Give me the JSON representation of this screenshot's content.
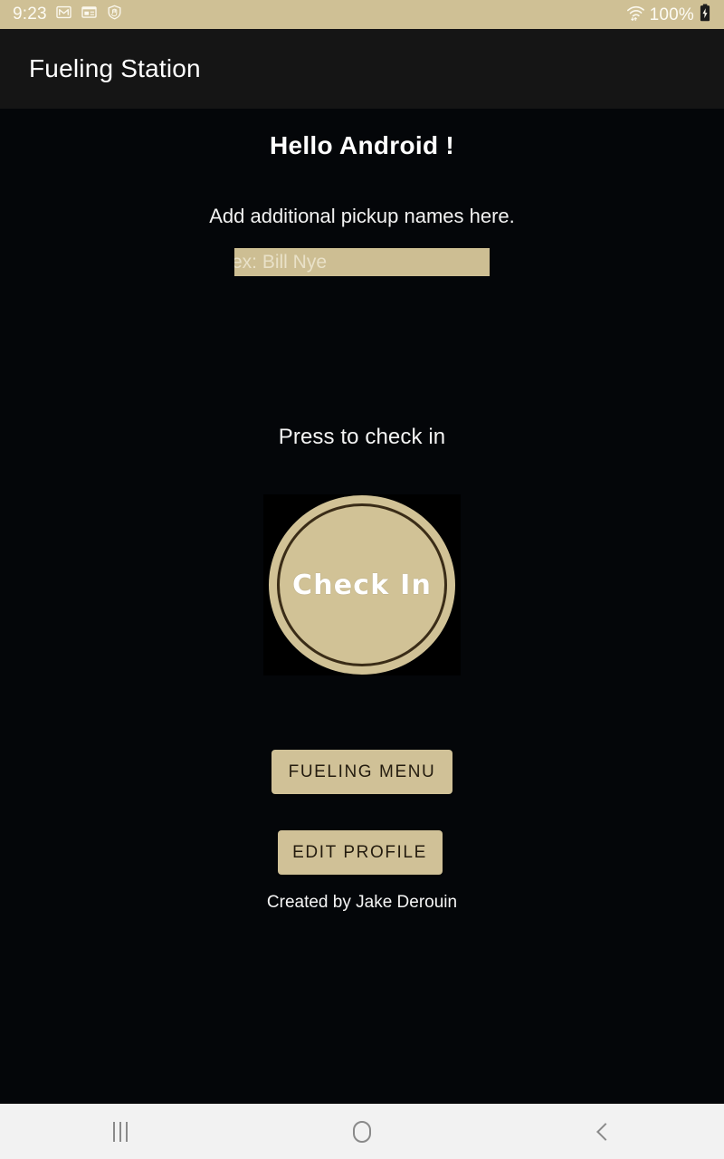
{
  "status_bar": {
    "clock": "9:23",
    "battery_percent": "100%",
    "icons": [
      "gmail-icon",
      "news-card-icon",
      "shield-hand-icon",
      "wifi-icon",
      "battery-charging-icon"
    ],
    "background_color": "#cfc095",
    "text_color": "#fdfbf3"
  },
  "app_bar": {
    "title": "Fueling Station",
    "background_color": "#151515",
    "title_color": "#ffffff"
  },
  "main": {
    "greeting": "Hello Android !",
    "instruction": "Add additional pickup names here.",
    "name_input": {
      "value": "",
      "placeholder": "ex: Bill Nye",
      "background_color": "#cdbe93",
      "placeholder_color": "#e9e1c8"
    },
    "press_label": "Press to check in",
    "check_in_button": {
      "label": "Check In",
      "circle_color": "#d1c296",
      "ring_color": "#3a2c17",
      "label_color": "#ffffff",
      "backdrop_color": "#000000"
    },
    "fueling_menu_button": {
      "label": "FUELING MENU",
      "background_color": "#d0c197",
      "text_color": "#241c0f"
    },
    "edit_profile_button": {
      "label": "EDIT PROFILE",
      "background_color": "#d0c197",
      "text_color": "#241c0f"
    },
    "credit": "Created by Jake Derouin",
    "background_color": "#040609"
  },
  "nav_bar": {
    "recents_label": "Recents",
    "home_label": "Home",
    "back_label": "Back",
    "background_color": "#f2f2f2",
    "icon_color": "#8a8a8a"
  }
}
